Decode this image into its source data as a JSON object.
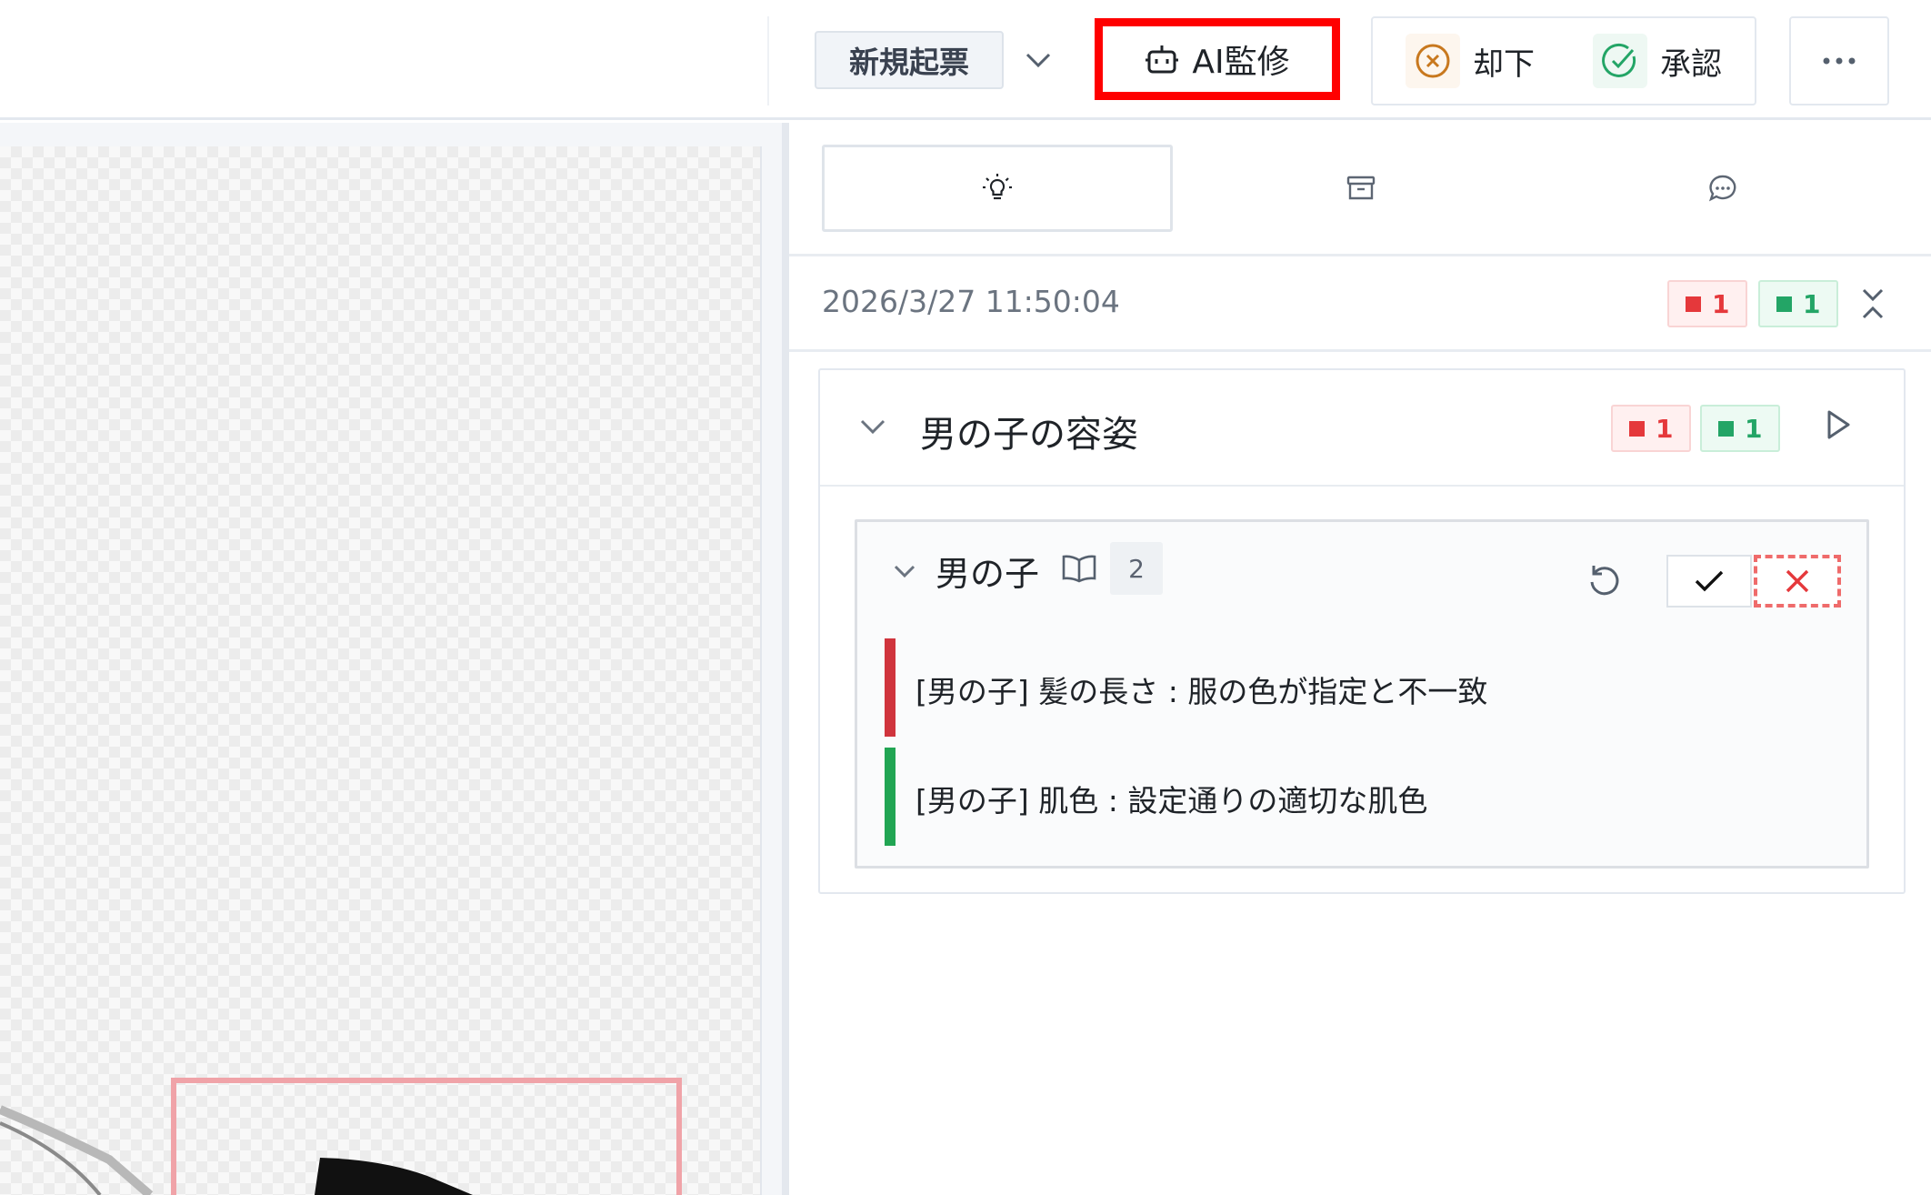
{
  "toolbar": {
    "new_label": "新規起票",
    "ai_label": "AI監修",
    "reject_label": "却下",
    "approve_label": "承認",
    "colors": {
      "highlight": "#ff0000",
      "reject": "#c8781e",
      "approve": "#23a566"
    }
  },
  "panel": {
    "tabs": [
      {
        "icon": "lightbulb-icon",
        "active": true
      },
      {
        "icon": "archive-icon",
        "active": false
      },
      {
        "icon": "chat-bubble-icon",
        "active": false
      }
    ],
    "review": {
      "timestamp": "2026/3/27 11:50:04",
      "ng_count": "1",
      "ok_count": "1"
    },
    "section": {
      "title": "男の子の容姿",
      "ng_count": "1",
      "ok_count": "1",
      "item": {
        "title": "男の子",
        "count": "2",
        "findings": [
          {
            "status": "ng",
            "text": "[男の子] 髪の長さ : 服の色が指定と不一致",
            "color": "#d0343d"
          },
          {
            "status": "ok",
            "text": "[男の子] 肌色 : 設定通りの適切な肌色",
            "color": "#21a553"
          }
        ]
      }
    }
  }
}
